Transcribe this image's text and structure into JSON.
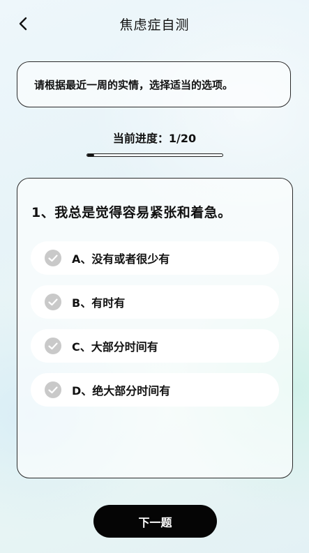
{
  "header": {
    "title": "焦虑症自测",
    "back_icon": "chevron-left-icon"
  },
  "instruction": "请根据最近一周的实情，选择适当的选项。",
  "progress": {
    "label": "当前进度：1/20",
    "current": 1,
    "total": 20,
    "fraction": 0.05
  },
  "question": {
    "text": "1、我总是觉得容易紧张和着急。",
    "options": [
      {
        "label": "A、没有或者很少有",
        "icon": "check-circle-icon"
      },
      {
        "label": "B、有时有",
        "icon": "check-circle-icon"
      },
      {
        "label": "C、大部分时间有",
        "icon": "check-circle-icon"
      },
      {
        "label": "D、绝大部分时间有",
        "icon": "check-circle-icon"
      }
    ]
  },
  "next_button": {
    "label": "下一题"
  },
  "colors": {
    "accent": "#050505",
    "check_circle": "#c9c9c9",
    "card_border": "#2a2a2a"
  }
}
